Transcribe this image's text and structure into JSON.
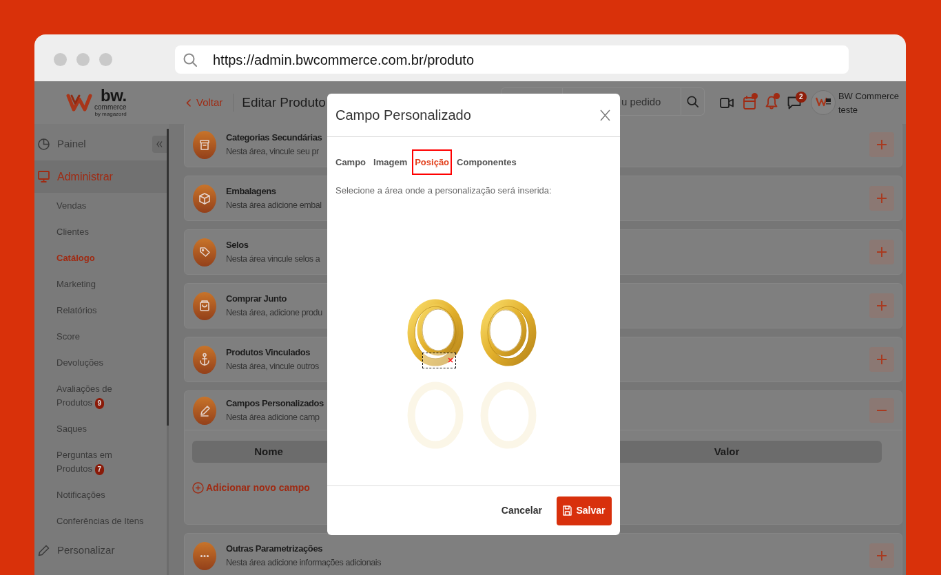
{
  "browser": {
    "url": "https://admin.bwcommerce.com.br/produto"
  },
  "logo": {
    "name": "bw.",
    "subtitle": "commerce",
    "byline": "by magazord"
  },
  "header": {
    "back_link": "Voltar",
    "title": "Editar Produto",
    "search": {
      "placeholder": "u pedido"
    },
    "icons": [
      {
        "kind": "video",
        "dot": false
      },
      {
        "kind": "calendar",
        "dot": true
      },
      {
        "kind": "bell",
        "dot": true
      },
      {
        "kind": "chat",
        "dot": false,
        "badge": "2"
      }
    ],
    "user": {
      "name": "BW Commerce",
      "role": "teste"
    }
  },
  "sidebar": {
    "sections": [
      {
        "label": "Painel",
        "kind": "dashboard",
        "expanded": false
      },
      {
        "label": "Administrar",
        "kind": "admin",
        "expanded": true,
        "children": [
          {
            "label": "Vendas",
            "selected": false
          },
          {
            "label": "Clientes",
            "selected": false
          },
          {
            "label": "Catálogo",
            "selected": true
          },
          {
            "label": "Marketing",
            "selected": false
          },
          {
            "label": "Relatórios",
            "selected": false
          },
          {
            "label": "Score",
            "selected": false
          },
          {
            "label": "Devoluções",
            "selected": false
          },
          {
            "label": "Avaliações de Produtos",
            "selected": false,
            "badge": "9"
          },
          {
            "label": "Saques",
            "selected": false
          },
          {
            "label": "Perguntas em Produtos",
            "selected": false,
            "badge": "7"
          },
          {
            "label": "Notificações",
            "selected": false
          },
          {
            "label": "Conferências de Itens",
            "selected": false
          }
        ]
      },
      {
        "label": "Personalizar",
        "kind": "customize",
        "expanded": false
      }
    ]
  },
  "cards": [
    {
      "kind": "archive",
      "title": "Categorias Secundárias",
      "description": "Nesta área, vincule seu pr",
      "expanded": false
    },
    {
      "kind": "package",
      "title": "Embalagens",
      "description": "Nesta área adicione embal",
      "expanded": false
    },
    {
      "kind": "tag",
      "title": "Selos",
      "description": "Nesta área vincule selos a",
      "expanded": false
    },
    {
      "kind": "bag",
      "title": "Comprar Junto",
      "description": "Nesta área, adicione produ",
      "expanded": false
    },
    {
      "kind": "anchor",
      "title": "Produtos Vinculados",
      "description": "Nesta área, vincule outros",
      "expanded": false
    },
    {
      "kind": "pencil",
      "title": "Campos Personalizados",
      "description": "Nesta área adicione camp",
      "expanded": true,
      "table": {
        "columns": [
          "Nome",
          "Valor"
        ]
      },
      "add_link": "Adicionar novo campo"
    },
    {
      "kind": "more",
      "title": "Outras Parametrizações",
      "description": "Nesta área adicione informações adicionais",
      "expanded": false
    }
  ],
  "modal": {
    "title": "Campo Personalizado",
    "tabs": [
      {
        "label": "Campo",
        "selected": false
      },
      {
        "label": "Imagem",
        "selected": false
      },
      {
        "label": "Posição",
        "selected": true
      },
      {
        "label": "Componentes",
        "selected": false
      }
    ],
    "instruction": "Selecione a área onde a personalização será inserida:",
    "buttons": [
      {
        "kind": "secondary",
        "label": "Cancelar"
      },
      {
        "kind": "primary",
        "label": "Salvar"
      }
    ]
  }
}
